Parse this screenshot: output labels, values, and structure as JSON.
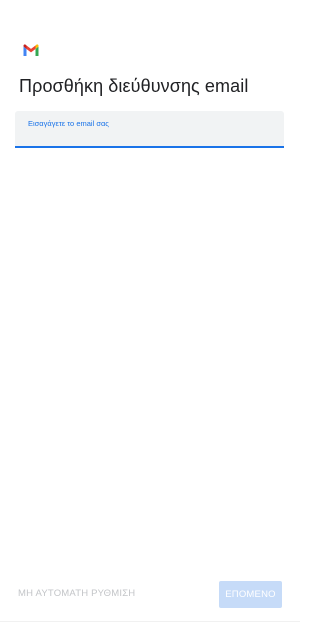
{
  "app": {
    "logo_icon": "gmail-logo-icon"
  },
  "header": {
    "title": "Προσθήκη διεύθυνσης email"
  },
  "email_field": {
    "label": "Εισαγάγετε το email σας",
    "value": ""
  },
  "footer": {
    "manual_setup_label": "ΜΗ ΑΥΤΟΜΑΤΗ ΡΥΘΜΙΣΗ",
    "next_label": "ΕΠΟΜΕΝΟ"
  },
  "colors": {
    "accent": "#1a73e8",
    "field_background": "#f1f3f4",
    "disabled_button": "#c6dbf8",
    "disabled_text": "#c3c5c8"
  }
}
